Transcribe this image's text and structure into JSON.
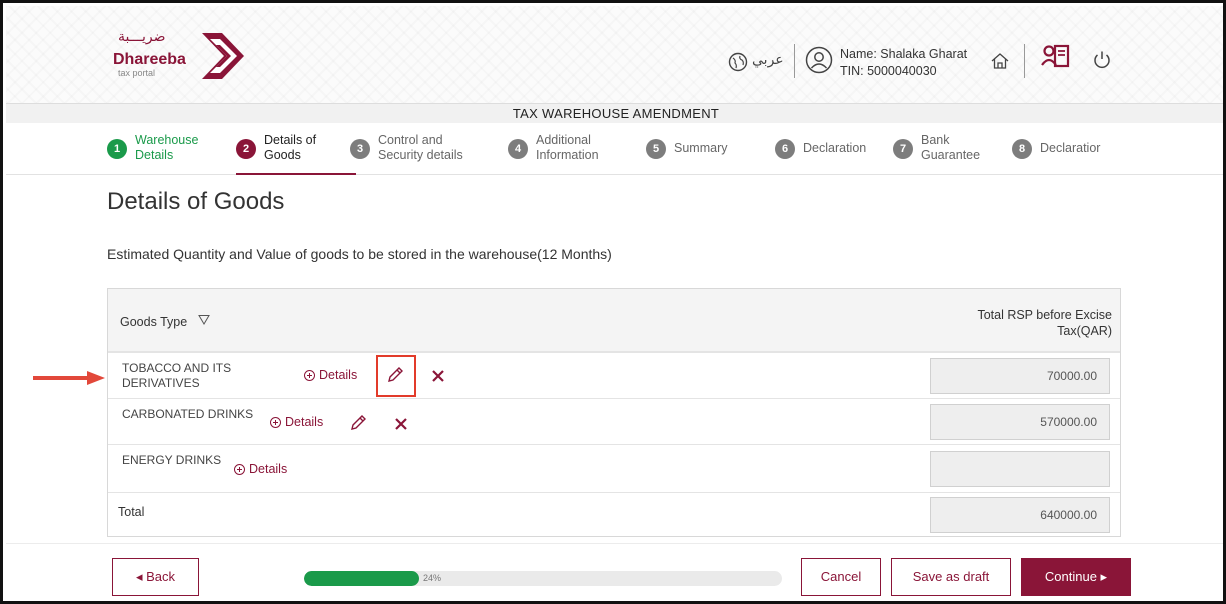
{
  "header": {
    "logo_arabic": "ضريـــبة",
    "logo_name": "Dhareeba",
    "logo_sub": "tax portal",
    "language_label": "عربي",
    "user_name": "Name: Shalaka Gharat",
    "user_tin": "TIN: 5000040030"
  },
  "page_header": "TAX WAREHOUSE AMENDMENT",
  "steps": [
    {
      "num": "1",
      "label": "Warehouse\nDetails",
      "state": "done"
    },
    {
      "num": "2",
      "label": "Details of\nGoods",
      "state": "active"
    },
    {
      "num": "3",
      "label": "Control and\nSecurity details",
      "state": "pending"
    },
    {
      "num": "4",
      "label": "Additional\nInformation",
      "state": "pending"
    },
    {
      "num": "5",
      "label": "Summary",
      "state": "pending"
    },
    {
      "num": "6",
      "label": "Declaration",
      "state": "pending"
    },
    {
      "num": "7",
      "label": "Bank\nGuarantee",
      "state": "pending"
    },
    {
      "num": "8",
      "label": "Declaratior",
      "state": "pending"
    }
  ],
  "main": {
    "title": "Details of Goods",
    "subtitle": "Estimated Quantity and Value of goods to be stored in the warehouse(12 Months)"
  },
  "table": {
    "col_goods": "Goods Type",
    "col_rsp": "Total RSP before Excise\nTax(QAR)",
    "details_label": "Details",
    "rows": [
      {
        "name": "TOBACCO AND ITS\nDERIVATIVES",
        "amount": "70000.00"
      },
      {
        "name": "CARBONATED DRINKS",
        "amount": "570000.00"
      },
      {
        "name": "ENERGY DRINKS",
        "amount": ""
      }
    ],
    "total_label": "Total",
    "total_amount": "640000.00"
  },
  "footer": {
    "back_label": "◂  Back",
    "progress_percent": 24,
    "progress_label": "24%",
    "cancel_label": "Cancel",
    "save_draft_label": "Save as draft",
    "continue_label": "Continue  ▸"
  },
  "colors": {
    "brand": "#8a1538",
    "success": "#1a9a4a",
    "highlight": "#e23b2a"
  }
}
